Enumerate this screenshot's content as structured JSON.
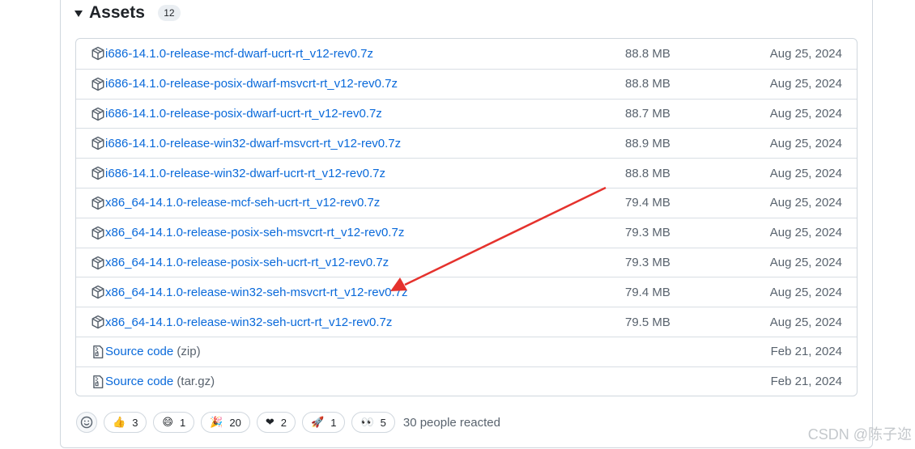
{
  "assets": {
    "title": "Assets",
    "count": "12",
    "rows": [
      {
        "name": "i686-14.1.0-release-mcf-dwarf-ucrt-rt_v12-rev0.7z",
        "size": "88.8 MB",
        "date": "Aug 25, 2024",
        "icon": "package-icon"
      },
      {
        "name": "i686-14.1.0-release-posix-dwarf-msvcrt-rt_v12-rev0.7z",
        "size": "88.8 MB",
        "date": "Aug 25, 2024",
        "icon": "package-icon"
      },
      {
        "name": "i686-14.1.0-release-posix-dwarf-ucrt-rt_v12-rev0.7z",
        "size": "88.7 MB",
        "date": "Aug 25, 2024",
        "icon": "package-icon"
      },
      {
        "name": "i686-14.1.0-release-win32-dwarf-msvcrt-rt_v12-rev0.7z",
        "size": "88.9 MB",
        "date": "Aug 25, 2024",
        "icon": "package-icon"
      },
      {
        "name": "i686-14.1.0-release-win32-dwarf-ucrt-rt_v12-rev0.7z",
        "size": "88.8 MB",
        "date": "Aug 25, 2024",
        "icon": "package-icon"
      },
      {
        "name": "x86_64-14.1.0-release-mcf-seh-ucrt-rt_v12-rev0.7z",
        "size": "79.4 MB",
        "date": "Aug 25, 2024",
        "icon": "package-icon"
      },
      {
        "name": "x86_64-14.1.0-release-posix-seh-msvcrt-rt_v12-rev0.7z",
        "size": "79.3 MB",
        "date": "Aug 25, 2024",
        "icon": "package-icon"
      },
      {
        "name": "x86_64-14.1.0-release-posix-seh-ucrt-rt_v12-rev0.7z",
        "size": "79.3 MB",
        "date": "Aug 25, 2024",
        "icon": "package-icon"
      },
      {
        "name": "x86_64-14.1.0-release-win32-seh-msvcrt-rt_v12-rev0.7z",
        "size": "79.4 MB",
        "date": "Aug 25, 2024",
        "icon": "package-icon"
      },
      {
        "name": "x86_64-14.1.0-release-win32-seh-ucrt-rt_v12-rev0.7z",
        "size": "79.5 MB",
        "date": "Aug 25, 2024",
        "icon": "package-icon"
      }
    ],
    "source_rows": [
      {
        "name": "Source code",
        "suffix": "(zip)",
        "size": "",
        "date": "Feb 21, 2024",
        "icon": "file-zip-icon"
      },
      {
        "name": "Source code",
        "suffix": "(tar.gz)",
        "size": "",
        "date": "Feb 21, 2024",
        "icon": "file-zip-icon"
      }
    ]
  },
  "reactions": {
    "add_icon": "smiley-icon",
    "items": [
      {
        "emoji": "👍",
        "count": "3",
        "icon": "thumbs-up-icon"
      },
      {
        "emoji": "😄",
        "count": "1",
        "icon": "laugh-icon"
      },
      {
        "emoji": "🎉",
        "count": "20",
        "icon": "hooray-icon"
      },
      {
        "emoji": "❤",
        "count": "2",
        "icon": "heart-icon"
      },
      {
        "emoji": "🚀",
        "count": "1",
        "icon": "rocket-icon"
      },
      {
        "emoji": "👀",
        "count": "5",
        "icon": "eyes-icon"
      }
    ],
    "summary": "30 people reacted"
  },
  "watermark": "CSDN @陈子迩",
  "colors": {
    "link": "#0969da",
    "muted": "#59636e",
    "border": "#d0d7de",
    "annotation_arrow": "#e5322d"
  }
}
